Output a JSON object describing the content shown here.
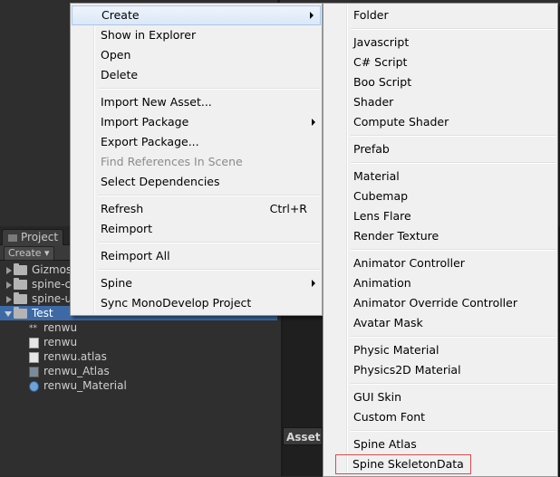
{
  "context_menu": {
    "items": [
      {
        "label": "Create",
        "submenu": true,
        "highlighted": true
      },
      {
        "label": "Show in Explorer"
      },
      {
        "label": "Open"
      },
      {
        "label": "Delete"
      },
      {
        "separator": true
      },
      {
        "label": "Import New Asset..."
      },
      {
        "label": "Import Package",
        "submenu": true
      },
      {
        "label": "Export Package..."
      },
      {
        "label": "Find References In Scene",
        "disabled": true
      },
      {
        "label": "Select Dependencies"
      },
      {
        "separator": true
      },
      {
        "label": "Refresh",
        "shortcut": "Ctrl+R"
      },
      {
        "label": "Reimport"
      },
      {
        "separator": true
      },
      {
        "label": "Reimport All"
      },
      {
        "separator": true
      },
      {
        "label": "Spine",
        "submenu": true
      },
      {
        "label": "Sync MonoDevelop Project"
      }
    ]
  },
  "create_submenu": {
    "items": [
      {
        "label": "Folder"
      },
      {
        "separator": true
      },
      {
        "label": "Javascript"
      },
      {
        "label": "C# Script"
      },
      {
        "label": "Boo Script"
      },
      {
        "label": "Shader"
      },
      {
        "label": "Compute Shader"
      },
      {
        "separator": true
      },
      {
        "label": "Prefab"
      },
      {
        "separator": true
      },
      {
        "label": "Material"
      },
      {
        "label": "Cubemap"
      },
      {
        "label": "Lens Flare"
      },
      {
        "label": "Render Texture"
      },
      {
        "separator": true
      },
      {
        "label": "Animator Controller"
      },
      {
        "label": "Animation"
      },
      {
        "label": "Animator Override Controller"
      },
      {
        "label": "Avatar Mask"
      },
      {
        "separator": true
      },
      {
        "label": "Physic Material"
      },
      {
        "label": "Physics2D Material"
      },
      {
        "separator": true
      },
      {
        "label": "GUI Skin"
      },
      {
        "label": "Custom Font"
      },
      {
        "separator": true
      },
      {
        "label": "Spine Atlas"
      },
      {
        "label": "Spine SkeletonData",
        "boxed": true,
        "box_color": "#d94a4a"
      }
    ]
  },
  "project_panel": {
    "tab_label": "Project",
    "create_label": "Create ▾",
    "tree": [
      {
        "label": "Gizmos",
        "expanded": false
      },
      {
        "label": "spine-c",
        "expanded": false
      },
      {
        "label": "spine-u",
        "expanded": false
      },
      {
        "label": "Test",
        "expanded": true,
        "selected": true
      }
    ],
    "files": [
      {
        "label": "renwu",
        "icon": "script-icon"
      },
      {
        "label": "renwu",
        "icon": "text-file-icon"
      },
      {
        "label": "renwu.atlas",
        "icon": "text-file-icon"
      },
      {
        "label": "renwu_Atlas",
        "icon": "atlas-asset-icon"
      },
      {
        "label": "renwu_Material",
        "icon": "material-sphere-icon"
      }
    ]
  },
  "asset_panel": {
    "tab_label": "Asset"
  },
  "colors": {
    "selection": "#3d6aa7",
    "menu_bg": "#f0f0f0",
    "highlight_border": "#a8c7ec",
    "boxed_outline": "#d94a4a"
  }
}
